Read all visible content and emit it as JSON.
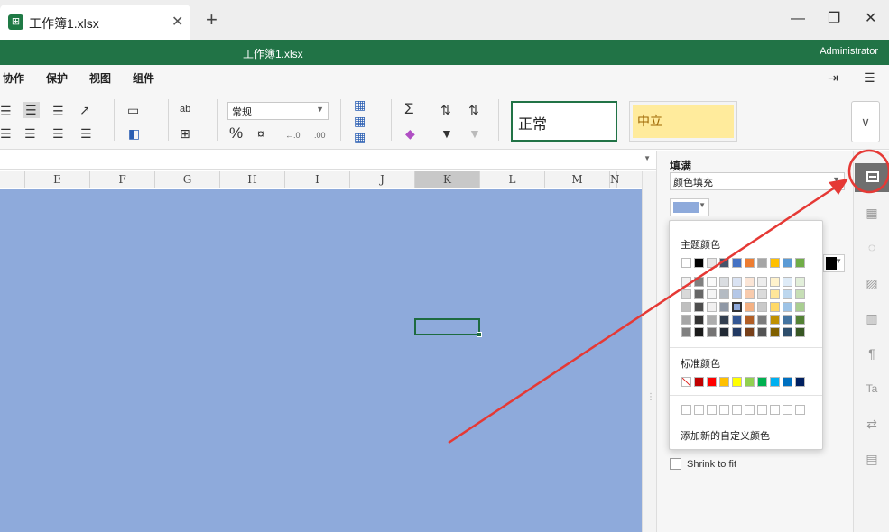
{
  "tab": {
    "title": "工作簿1.xlsx",
    "icon": "spreadsheet-icon"
  },
  "titlebar": {
    "document": "工作簿1.xlsx",
    "user": "Administrator"
  },
  "menus": [
    "协作",
    "保护",
    "视图",
    "组件"
  ],
  "ribbon": {
    "number_format": "常规",
    "style_normal": "正常",
    "style_neutral": "中立"
  },
  "columns": [
    "E",
    "F",
    "G",
    "H",
    "I",
    "J",
    "K",
    "L",
    "M",
    "N"
  ],
  "selected_column": "K",
  "sheet_fill_color": "#8eaadb",
  "panel": {
    "fill_title": "填满",
    "fill_type": "颜色填充",
    "shrink_label": "Shrink to fit"
  },
  "color_popup": {
    "theme_title": "主题颜色",
    "standard_title": "标准颜色",
    "custom_label": "添加新的自定义颜色",
    "theme_row": [
      "#ffffff",
      "#000000",
      "#e7e6e6",
      "#44546a",
      "#4472c4",
      "#ed7d31",
      "#a5a5a5",
      "#ffc000",
      "#5b9bd5",
      "#70ad47"
    ],
    "standard_row": [
      "#c00000",
      "#ff0000",
      "#ffc000",
      "#ffff00",
      "#92d050",
      "#00b050",
      "#00b0f0",
      "#0070c0",
      "#002060"
    ]
  },
  "accent_color": "#217346"
}
